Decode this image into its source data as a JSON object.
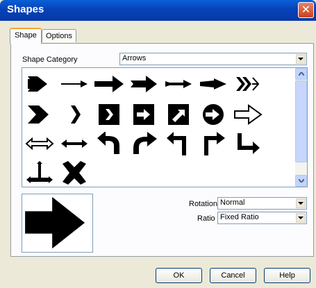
{
  "window": {
    "title": "Shapes",
    "close_symbol": "✕"
  },
  "tabs": [
    {
      "label": "Shape",
      "active": true
    },
    {
      "label": "Options",
      "active": false
    }
  ],
  "shape_category": {
    "label": "Shape Category",
    "selected": "Arrows"
  },
  "shapes": [
    [
      "arrow-chevron-block-icon",
      "arrow-thin-right-icon",
      "arrow-block-right-icon",
      "arrow-block-pointed-icon",
      "arrow-tail-right-icon",
      "arrow-wedge-right-icon",
      "arrow-chevrons-icon"
    ],
    [
      "chevron-big-icon",
      "chevron-small-icon",
      "chevron-in-square-icon",
      "arrow-in-square-icon",
      "arrow-diagonal-square-icon",
      "arrow-in-circle-icon",
      "arrow-outline-right-icon"
    ],
    [
      "arrow-double-outline-icon",
      "arrow-double-solid-icon",
      "arrow-uturn-left-icon",
      "arrow-uturn-right-icon",
      "arrow-corner-left-icon",
      "arrow-corner-right-icon",
      "arrow-down-right-icon"
    ],
    [
      "arrow-tee-icon",
      "cross-x-icon"
    ]
  ],
  "rotation": {
    "label": "Rotation",
    "selected": "Normal"
  },
  "ratio": {
    "label": "Ratio",
    "selected": "Fixed Ratio"
  },
  "buttons": {
    "ok": "OK",
    "cancel": "Cancel",
    "help": "Help"
  },
  "colors": {
    "titlebar": "#0842b8",
    "dialog": "#ece9d8",
    "border": "#7f9db9"
  }
}
